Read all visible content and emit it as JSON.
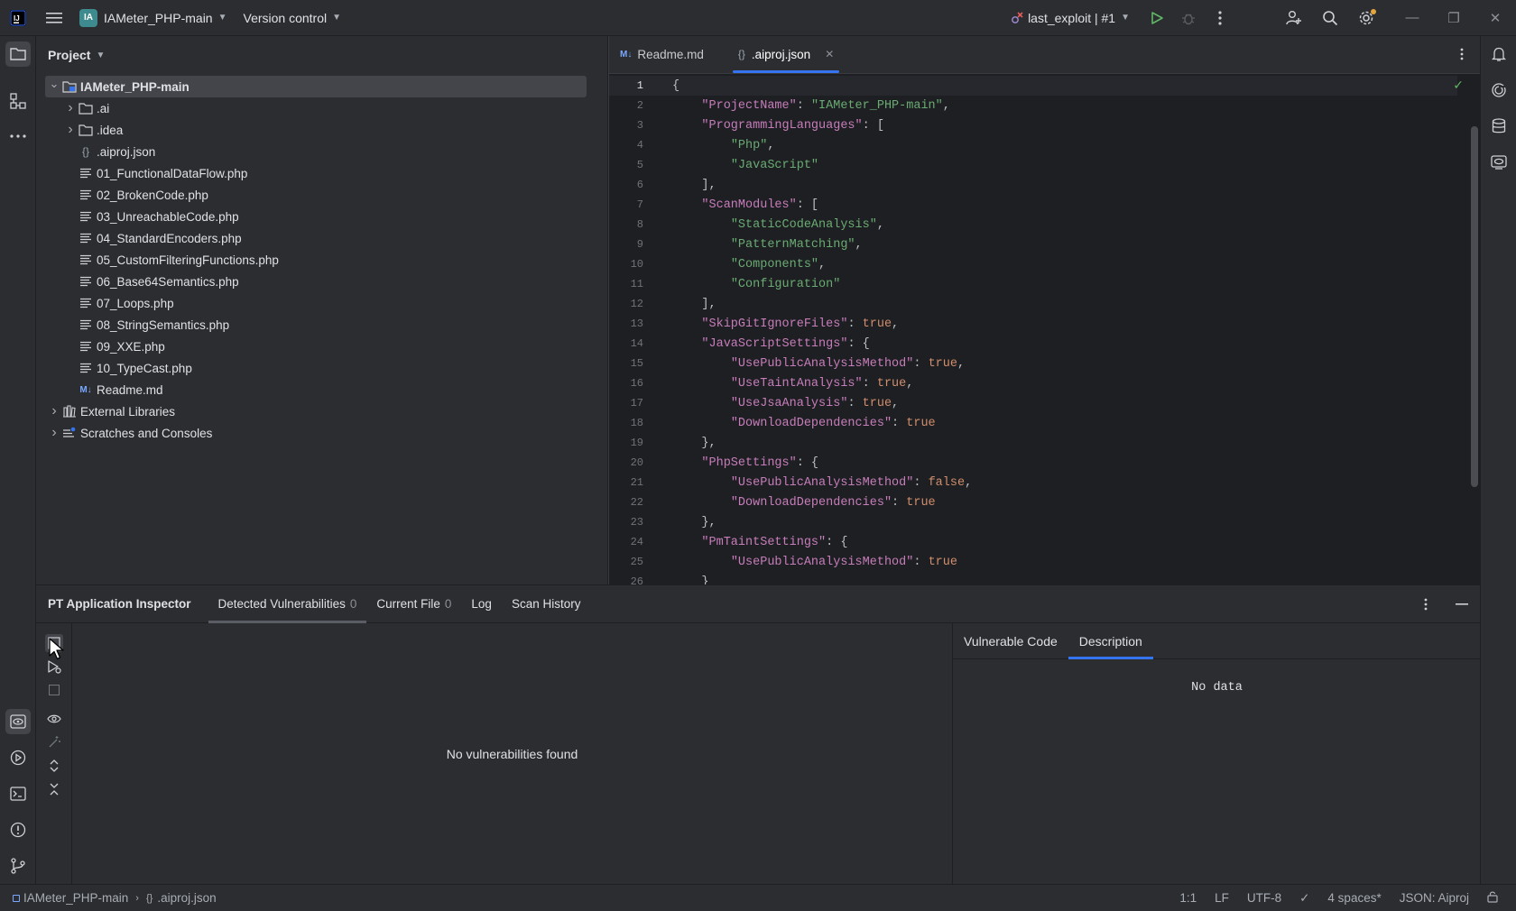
{
  "titlebar": {
    "project_badge": "IA",
    "project_name": "IAMeter_PHP-main",
    "vcs_label": "Version control",
    "run_config": "last_exploit | #1"
  },
  "project_panel": {
    "title": "Project",
    "tree": [
      {
        "label": "IAMeter_PHP-main",
        "kind": "root-folder",
        "depth": 0,
        "expand": "open",
        "selected": true
      },
      {
        "label": ".ai",
        "kind": "folder",
        "depth": 1,
        "expand": "closed"
      },
      {
        "label": ".idea",
        "kind": "folder",
        "depth": 1,
        "expand": "closed"
      },
      {
        "label": ".aiproj.json",
        "kind": "json",
        "depth": 1,
        "expand": "none"
      },
      {
        "label": "01_FunctionalDataFlow.php",
        "kind": "text",
        "depth": 1,
        "expand": "none"
      },
      {
        "label": "02_BrokenCode.php",
        "kind": "text",
        "depth": 1,
        "expand": "none"
      },
      {
        "label": "03_UnreachableCode.php",
        "kind": "text",
        "depth": 1,
        "expand": "none"
      },
      {
        "label": "04_StandardEncoders.php",
        "kind": "text",
        "depth": 1,
        "expand": "none"
      },
      {
        "label": "05_CustomFilteringFunctions.php",
        "kind": "text",
        "depth": 1,
        "expand": "none"
      },
      {
        "label": "06_Base64Semantics.php",
        "kind": "text",
        "depth": 1,
        "expand": "none"
      },
      {
        "label": "07_Loops.php",
        "kind": "text",
        "depth": 1,
        "expand": "none"
      },
      {
        "label": "08_StringSemantics.php",
        "kind": "text",
        "depth": 1,
        "expand": "none"
      },
      {
        "label": "09_XXE.php",
        "kind": "text",
        "depth": 1,
        "expand": "none"
      },
      {
        "label": "10_TypeCast.php",
        "kind": "text",
        "depth": 1,
        "expand": "none"
      },
      {
        "label": "Readme.md",
        "kind": "markdown",
        "depth": 1,
        "expand": "none"
      },
      {
        "label": "External Libraries",
        "kind": "library",
        "depth": 0,
        "expand": "closed"
      },
      {
        "label": "Scratches and Consoles",
        "kind": "scratch",
        "depth": 0,
        "expand": "closed"
      }
    ]
  },
  "editor": {
    "tabs": [
      {
        "label": "Readme.md",
        "icon": "M↓",
        "active": false,
        "closable": false
      },
      {
        "label": ".aiproj.json",
        "icon": "{}",
        "active": true,
        "closable": true
      }
    ],
    "lines": [
      [
        {
          "t": "{",
          "c": "p"
        }
      ],
      [
        {
          "t": "    ",
          "c": "p"
        },
        {
          "t": "\"ProjectName\"",
          "c": "k"
        },
        {
          "t": ": ",
          "c": "p"
        },
        {
          "t": "\"IAMeter_PHP-main\"",
          "c": "s"
        },
        {
          "t": ",",
          "c": "p"
        }
      ],
      [
        {
          "t": "    ",
          "c": "p"
        },
        {
          "t": "\"ProgrammingLanguages\"",
          "c": "k"
        },
        {
          "t": ": [",
          "c": "p"
        }
      ],
      [
        {
          "t": "        ",
          "c": "p"
        },
        {
          "t": "\"Php\"",
          "c": "s"
        },
        {
          "t": ",",
          "c": "p"
        }
      ],
      [
        {
          "t": "        ",
          "c": "p"
        },
        {
          "t": "\"JavaScript\"",
          "c": "s"
        }
      ],
      [
        {
          "t": "    ],",
          "c": "p"
        }
      ],
      [
        {
          "t": "    ",
          "c": "p"
        },
        {
          "t": "\"ScanModules\"",
          "c": "k"
        },
        {
          "t": ": [",
          "c": "p"
        }
      ],
      [
        {
          "t": "        ",
          "c": "p"
        },
        {
          "t": "\"StaticCodeAnalysis\"",
          "c": "s"
        },
        {
          "t": ",",
          "c": "p"
        }
      ],
      [
        {
          "t": "        ",
          "c": "p"
        },
        {
          "t": "\"PatternMatching\"",
          "c": "s"
        },
        {
          "t": ",",
          "c": "p"
        }
      ],
      [
        {
          "t": "        ",
          "c": "p"
        },
        {
          "t": "\"Components\"",
          "c": "s"
        },
        {
          "t": ",",
          "c": "p"
        }
      ],
      [
        {
          "t": "        ",
          "c": "p"
        },
        {
          "t": "\"Configuration\"",
          "c": "s"
        }
      ],
      [
        {
          "t": "    ],",
          "c": "p"
        }
      ],
      [
        {
          "t": "    ",
          "c": "p"
        },
        {
          "t": "\"SkipGitIgnoreFiles\"",
          "c": "k"
        },
        {
          "t": ": ",
          "c": "p"
        },
        {
          "t": "true",
          "c": "b"
        },
        {
          "t": ",",
          "c": "p"
        }
      ],
      [
        {
          "t": "    ",
          "c": "p"
        },
        {
          "t": "\"JavaScriptSettings\"",
          "c": "k"
        },
        {
          "t": ": {",
          "c": "p"
        }
      ],
      [
        {
          "t": "        ",
          "c": "p"
        },
        {
          "t": "\"UsePublicAnalysisMethod\"",
          "c": "k"
        },
        {
          "t": ": ",
          "c": "p"
        },
        {
          "t": "true",
          "c": "b"
        },
        {
          "t": ",",
          "c": "p"
        }
      ],
      [
        {
          "t": "        ",
          "c": "p"
        },
        {
          "t": "\"UseTaintAnalysis\"",
          "c": "k"
        },
        {
          "t": ": ",
          "c": "p"
        },
        {
          "t": "true",
          "c": "b"
        },
        {
          "t": ",",
          "c": "p"
        }
      ],
      [
        {
          "t": "        ",
          "c": "p"
        },
        {
          "t": "\"UseJsaAnalysis\"",
          "c": "k"
        },
        {
          "t": ": ",
          "c": "p"
        },
        {
          "t": "true",
          "c": "b"
        },
        {
          "t": ",",
          "c": "p"
        }
      ],
      [
        {
          "t": "        ",
          "c": "p"
        },
        {
          "t": "\"DownloadDependencies\"",
          "c": "k"
        },
        {
          "t": ": ",
          "c": "p"
        },
        {
          "t": "true",
          "c": "b"
        }
      ],
      [
        {
          "t": "    },",
          "c": "p"
        }
      ],
      [
        {
          "t": "    ",
          "c": "p"
        },
        {
          "t": "\"PhpSettings\"",
          "c": "k"
        },
        {
          "t": ": {",
          "c": "p"
        }
      ],
      [
        {
          "t": "        ",
          "c": "p"
        },
        {
          "t": "\"UsePublicAnalysisMethod\"",
          "c": "k"
        },
        {
          "t": ": ",
          "c": "p"
        },
        {
          "t": "false",
          "c": "b"
        },
        {
          "t": ",",
          "c": "p"
        }
      ],
      [
        {
          "t": "        ",
          "c": "p"
        },
        {
          "t": "\"DownloadDependencies\"",
          "c": "k"
        },
        {
          "t": ": ",
          "c": "p"
        },
        {
          "t": "true",
          "c": "b"
        }
      ],
      [
        {
          "t": "    },",
          "c": "p"
        }
      ],
      [
        {
          "t": "    ",
          "c": "p"
        },
        {
          "t": "\"PmTaintSettings\"",
          "c": "k"
        },
        {
          "t": ": {",
          "c": "p"
        }
      ],
      [
        {
          "t": "        ",
          "c": "p"
        },
        {
          "t": "\"UsePublicAnalysisMethod\"",
          "c": "k"
        },
        {
          "t": ": ",
          "c": "p"
        },
        {
          "t": "true",
          "c": "b"
        }
      ],
      [
        {
          "t": "    }",
          "c": "p"
        }
      ]
    ]
  },
  "bottom_panel": {
    "title": "PT Application Inspector",
    "tabs": [
      {
        "label": "Detected Vulnerabilities",
        "count": "0",
        "active": true
      },
      {
        "label": "Current File",
        "count": "0",
        "active": false
      },
      {
        "label": "Log",
        "count": "",
        "active": false
      },
      {
        "label": "Scan History",
        "count": "",
        "active": false
      }
    ],
    "empty_message": "No vulnerabilities found",
    "detail_tabs": [
      {
        "label": "Vulnerable Code",
        "active": false
      },
      {
        "label": "Description",
        "active": true
      }
    ],
    "detail_empty": "No data"
  },
  "statusbar": {
    "breadcrumb_project": "IAMeter_PHP-main",
    "breadcrumb_file": ".aiproj.json",
    "position": "1:1",
    "line_sep": "LF",
    "encoding": "UTF-8",
    "indent": "4 spaces*",
    "file_type": "JSON: Aiproj"
  },
  "colors": {
    "accent": "#3574f0",
    "json_key": "#c77dbb",
    "json_string": "#6aab73",
    "json_bool": "#cf8e6d"
  }
}
